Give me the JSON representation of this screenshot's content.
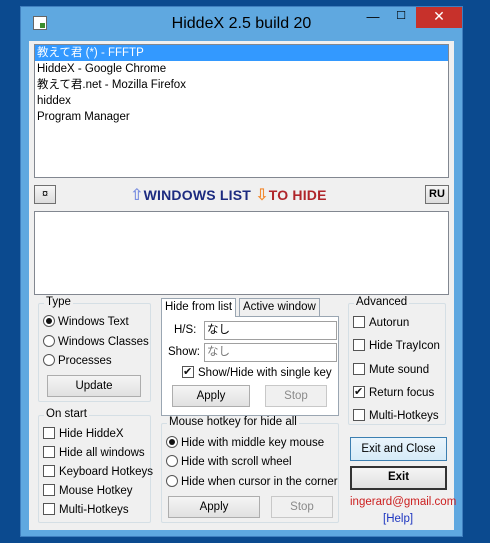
{
  "window": {
    "title": "HiddeX 2.5 build 20"
  },
  "title_controls": {
    "minimize": "—",
    "maximize": "☐",
    "close": "✕"
  },
  "windows_list": {
    "items": [
      {
        "label": "教えて君 (*) - FFFTP",
        "selected": true
      },
      {
        "label": "HiddeX - Google Chrome",
        "selected": false
      },
      {
        "label": "教えて君.net - Mozilla Firefox",
        "selected": false
      },
      {
        "label": "hiddex",
        "selected": false
      },
      {
        "label": "Program Manager",
        "selected": false
      }
    ]
  },
  "midbar": {
    "pin_button": "¤",
    "windows_list_label": "WINDOWS LIST",
    "to_hide_label": "TO HIDE",
    "language_button": "RU",
    "up_arrow_icon": "⇧",
    "down_arrow_icon": "⇩"
  },
  "type_group": {
    "title": "Type",
    "options": [
      "Windows Text",
      "Windows Classes",
      "Processes"
    ],
    "selected_index": 0,
    "update_button": "Update"
  },
  "onstart_group": {
    "title": "On start",
    "options": [
      "Hide HiddeX",
      "Hide all windows",
      "Keyboard Hotkeys",
      "Mouse Hotkey",
      "Multi-Hotkeys"
    ]
  },
  "tabs": {
    "labels": [
      "Hide from list",
      "Active window"
    ],
    "hs_label": "H/S:",
    "hs_value": "なし",
    "show_label": "Show:",
    "show_value": "なし",
    "single_key_label": "Show/Hide with single key",
    "apply_button": "Apply",
    "stop_button": "Stop"
  },
  "mouse_hotkey_group": {
    "title": "Mouse hotkey for hide all",
    "options": [
      "Hide with middle key mouse",
      "Hide with scroll wheel",
      "Hide when cursor in the corner"
    ],
    "selected_index": 0,
    "apply_button": "Apply",
    "stop_button": "Stop"
  },
  "advanced_group": {
    "title": "Advanced",
    "options": [
      {
        "label": "Autorun",
        "checked": false
      },
      {
        "label": "Hide TrayIcon",
        "checked": false
      },
      {
        "label": "Mute sound",
        "checked": false
      },
      {
        "label": "Return focus",
        "checked": true
      },
      {
        "label": "Multi-Hotkeys",
        "checked": false
      }
    ]
  },
  "actions": {
    "exit_close_button": "Exit and Close",
    "exit_button": "Exit",
    "email": "ingerard@gmail.com",
    "help_link": "[Help]"
  },
  "colors": {
    "desktop": "#0b4a8f",
    "window_frame": "#5fa8e0",
    "selection": "#3399ff",
    "close_button": "#c7312b"
  }
}
